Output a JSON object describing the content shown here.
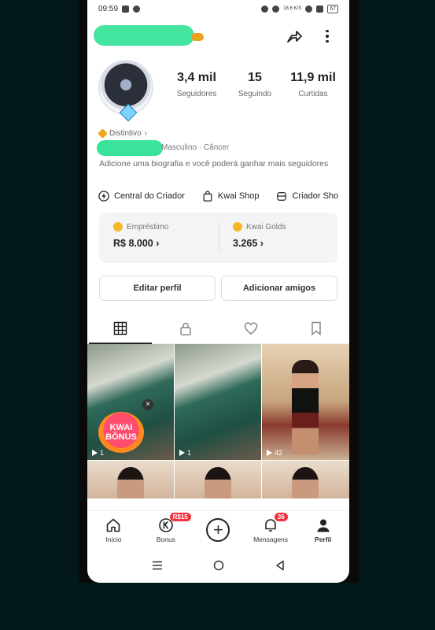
{
  "status_bar": {
    "time": "09:59",
    "network": "18,6 K/S",
    "battery": "67"
  },
  "profile": {
    "stats": [
      {
        "value": "3,4 mil",
        "label": "Seguidores"
      },
      {
        "value": "15",
        "label": "Seguindo"
      },
      {
        "value": "11,9 mil",
        "label": "Curtidas"
      }
    ],
    "badge_label": "Distintivo",
    "gender": "Masculino",
    "sign": "Câncer",
    "bio": "Adicione uma biografia e você poderá ganhar mais seguidores"
  },
  "shortcuts": [
    {
      "label": "Central do Criador",
      "icon": "lightning-icon"
    },
    {
      "label": "Kwai Shop",
      "icon": "shopping-bag-icon"
    },
    {
      "label": "Criador Sho",
      "icon": "store-icon"
    }
  ],
  "wallet": {
    "loan": {
      "label": "Empréstimo",
      "value": "R$ 8.000"
    },
    "golds": {
      "label": "Kwai Golds",
      "value": "3.265"
    }
  },
  "actions": {
    "edit_profile": "Editar perfil",
    "add_friends": "Adicionar amigos"
  },
  "grid": {
    "items": [
      {
        "count": "1",
        "badge": "KWAI BÔNUS"
      },
      {
        "count": "1"
      },
      {
        "count": "42"
      }
    ]
  },
  "bottom_nav": {
    "home": "Início",
    "bonus": "Bonus",
    "bonus_badge": "R$15",
    "messages": "Mensagens",
    "messages_badge": "36",
    "profile": "Perfil"
  },
  "colors": {
    "accent": "#f2333f",
    "coin": "#f5b928",
    "redaction": "#39e49a"
  }
}
